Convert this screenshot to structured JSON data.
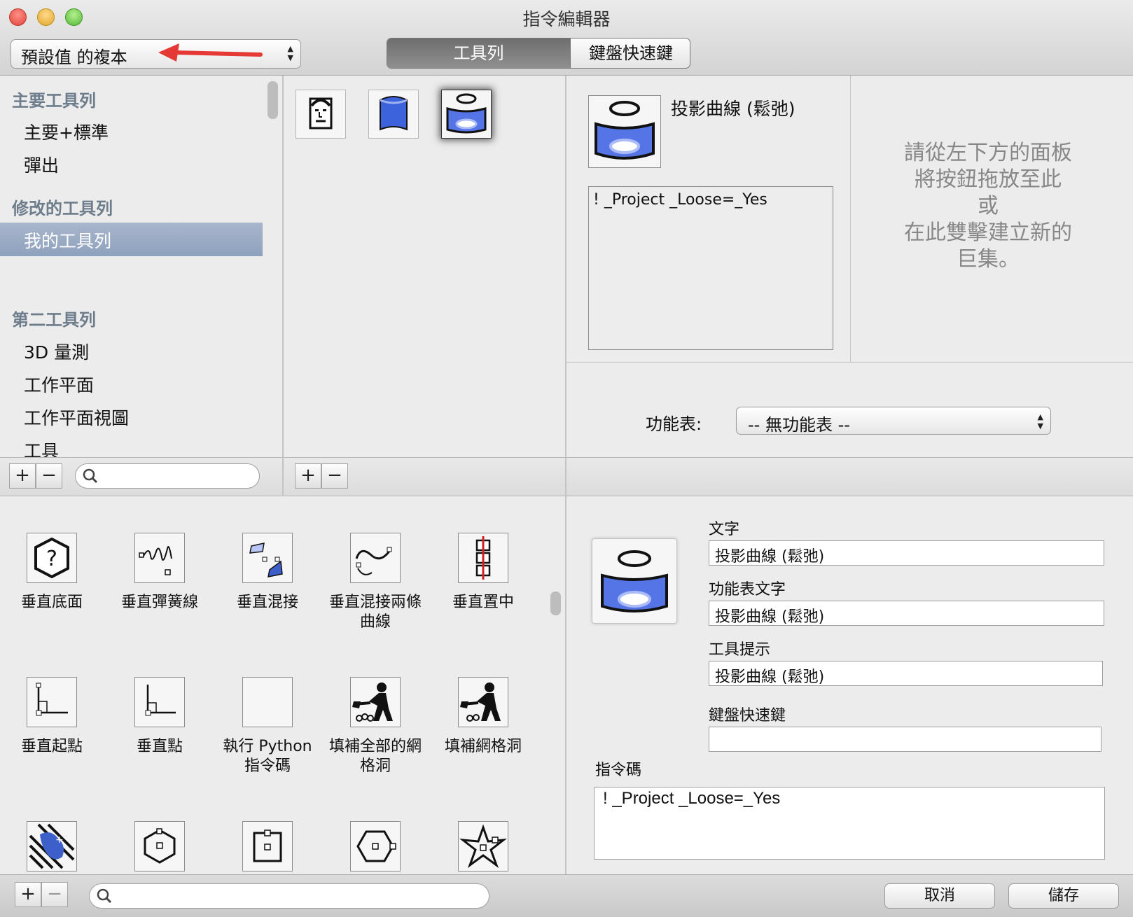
{
  "window": {
    "title": "指令編輯器"
  },
  "preset_select": {
    "value": "預設值 的複本"
  },
  "mode_tabs": [
    {
      "label": "工具列",
      "selected": true
    },
    {
      "label": "鍵盤快速鍵",
      "selected": false
    }
  ],
  "sidebar": {
    "sections": [
      {
        "title": "主要工具列",
        "items": [
          "主要+標準",
          "彈出"
        ]
      },
      {
        "title": "修改的工具列",
        "items": [
          "我的工具列"
        ]
      },
      {
        "title": "第二工具列",
        "items": [
          "3D 量測",
          "工作平面",
          "工作平面視圖",
          "工具"
        ]
      }
    ],
    "selected_item": "我的工具列"
  },
  "toolbar_buttons": [
    "face-icon",
    "cylinder-icon",
    "project-curve-icon"
  ],
  "detail": {
    "title": "投影曲線 (鬆弛)",
    "macro": "! _Project _Loose=_Yes",
    "hint_lines": [
      "請從左下方的面板",
      "將按鈕拖放至此",
      "或",
      "在此雙擊建立新的",
      "巨集。"
    ],
    "menu_label": "功能表:",
    "menu_value": "-- 無功能表 --"
  },
  "library": [
    {
      "label": "垂直底面",
      "icon": "help-hexagon-icon"
    },
    {
      "label": "垂直彈簧線",
      "icon": "spring-icon"
    },
    {
      "label": "垂直混接",
      "icon": "blend-icon"
    },
    {
      "label": "垂直混接兩條曲線",
      "icon": "blend-curves-icon"
    },
    {
      "label": "垂直置中",
      "icon": "center-icon"
    },
    {
      "label": "垂直起點",
      "icon": "perp-start-icon"
    },
    {
      "label": "垂直點",
      "icon": "perp-point-icon"
    },
    {
      "label": "執行 Python 指令碼",
      "icon": "blank-icon"
    },
    {
      "label": "填補全部的網格洞",
      "icon": "fill-all-holes-icon"
    },
    {
      "label": "填補網格洞",
      "icon": "fill-hole-icon"
    },
    {
      "label": "",
      "icon": "lizard-icon"
    },
    {
      "label": "",
      "icon": "hexagon-icon"
    },
    {
      "label": "",
      "icon": "square-point-icon"
    },
    {
      "label": "",
      "icon": "hexagon-point-icon"
    },
    {
      "label": "",
      "icon": "star-icon"
    }
  ],
  "form": {
    "text_label": "文字",
    "text_value": "投影曲線 (鬆弛)",
    "menu_text_label": "功能表文字",
    "menu_text_value": "投影曲線 (鬆弛)",
    "tooltip_label": "工具提示",
    "tooltip_value": "投影曲線 (鬆弛)",
    "shortcut_label": "鍵盤快速鍵",
    "shortcut_value": "",
    "macro_label": "指令碼",
    "macro_value": "! _Project _Loose=_Yes"
  },
  "footer": {
    "cancel_label": "取消",
    "save_label": "儲存"
  },
  "colors": {
    "selection": "#8ea1bd",
    "arrow": "#e53935",
    "icon_blue": "#4f6fe0"
  }
}
